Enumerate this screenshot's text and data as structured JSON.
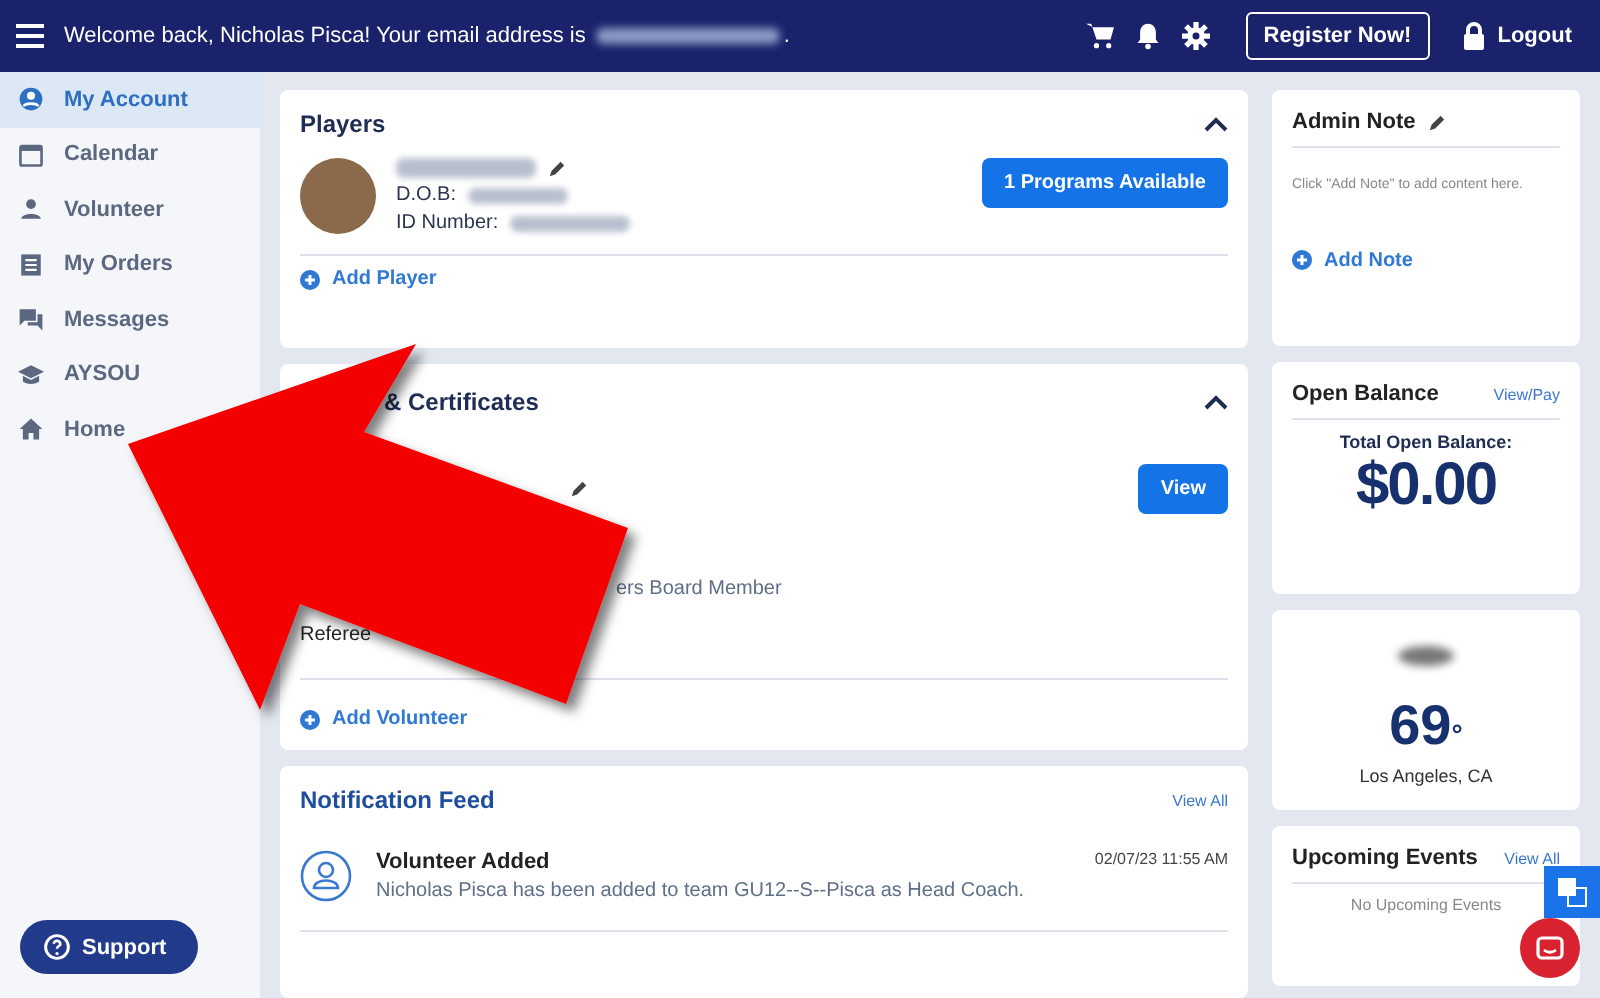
{
  "header": {
    "welcome": "Welcome back, Nicholas Pisca! Your email address is",
    "email_end": ".",
    "register": "Register Now!",
    "logout": "Logout"
  },
  "sidebar": {
    "items": [
      {
        "label": "My Account",
        "selected": true
      },
      {
        "label": "Calendar",
        "selected": false
      },
      {
        "label": "Volunteer",
        "selected": false
      },
      {
        "label": "My Orders",
        "selected": false
      },
      {
        "label": "Messages",
        "selected": false
      },
      {
        "label": "AYSOU",
        "selected": false
      },
      {
        "label": "Home",
        "selected": false
      }
    ],
    "support": "Support"
  },
  "players": {
    "title": "Players",
    "expanded": true,
    "dob_label": "D.O.B:",
    "id_label": "ID Number:",
    "programs_button": "1 Programs Available",
    "add": "Add Player"
  },
  "volunteer": {
    "title": "& Certificates",
    "expanded": true,
    "view": "View",
    "role": "ers Board Member",
    "cert": "Referee",
    "add": "Add Volunteer"
  },
  "feed": {
    "title": "Notification Feed",
    "view_all": "View All",
    "items": [
      {
        "title": "Volunteer Added",
        "time": "02/07/23 11:55 AM",
        "text": "Nicholas Pisca has been added to team GU12--S--Pisca as Head Coach."
      }
    ]
  },
  "admin_note": {
    "title": "Admin Note",
    "hint": "Click \"Add Note\" to add content here.",
    "add": "Add Note"
  },
  "balance": {
    "title": "Open Balance",
    "link": "View/Pay",
    "label": "Total Open Balance:",
    "amount": "$0.00"
  },
  "weather": {
    "temp": "69",
    "degree": "°",
    "city": "Los Angeles, CA"
  },
  "events": {
    "title": "Upcoming Events",
    "view_all": "View All",
    "empty": "No Upcoming Events"
  }
}
